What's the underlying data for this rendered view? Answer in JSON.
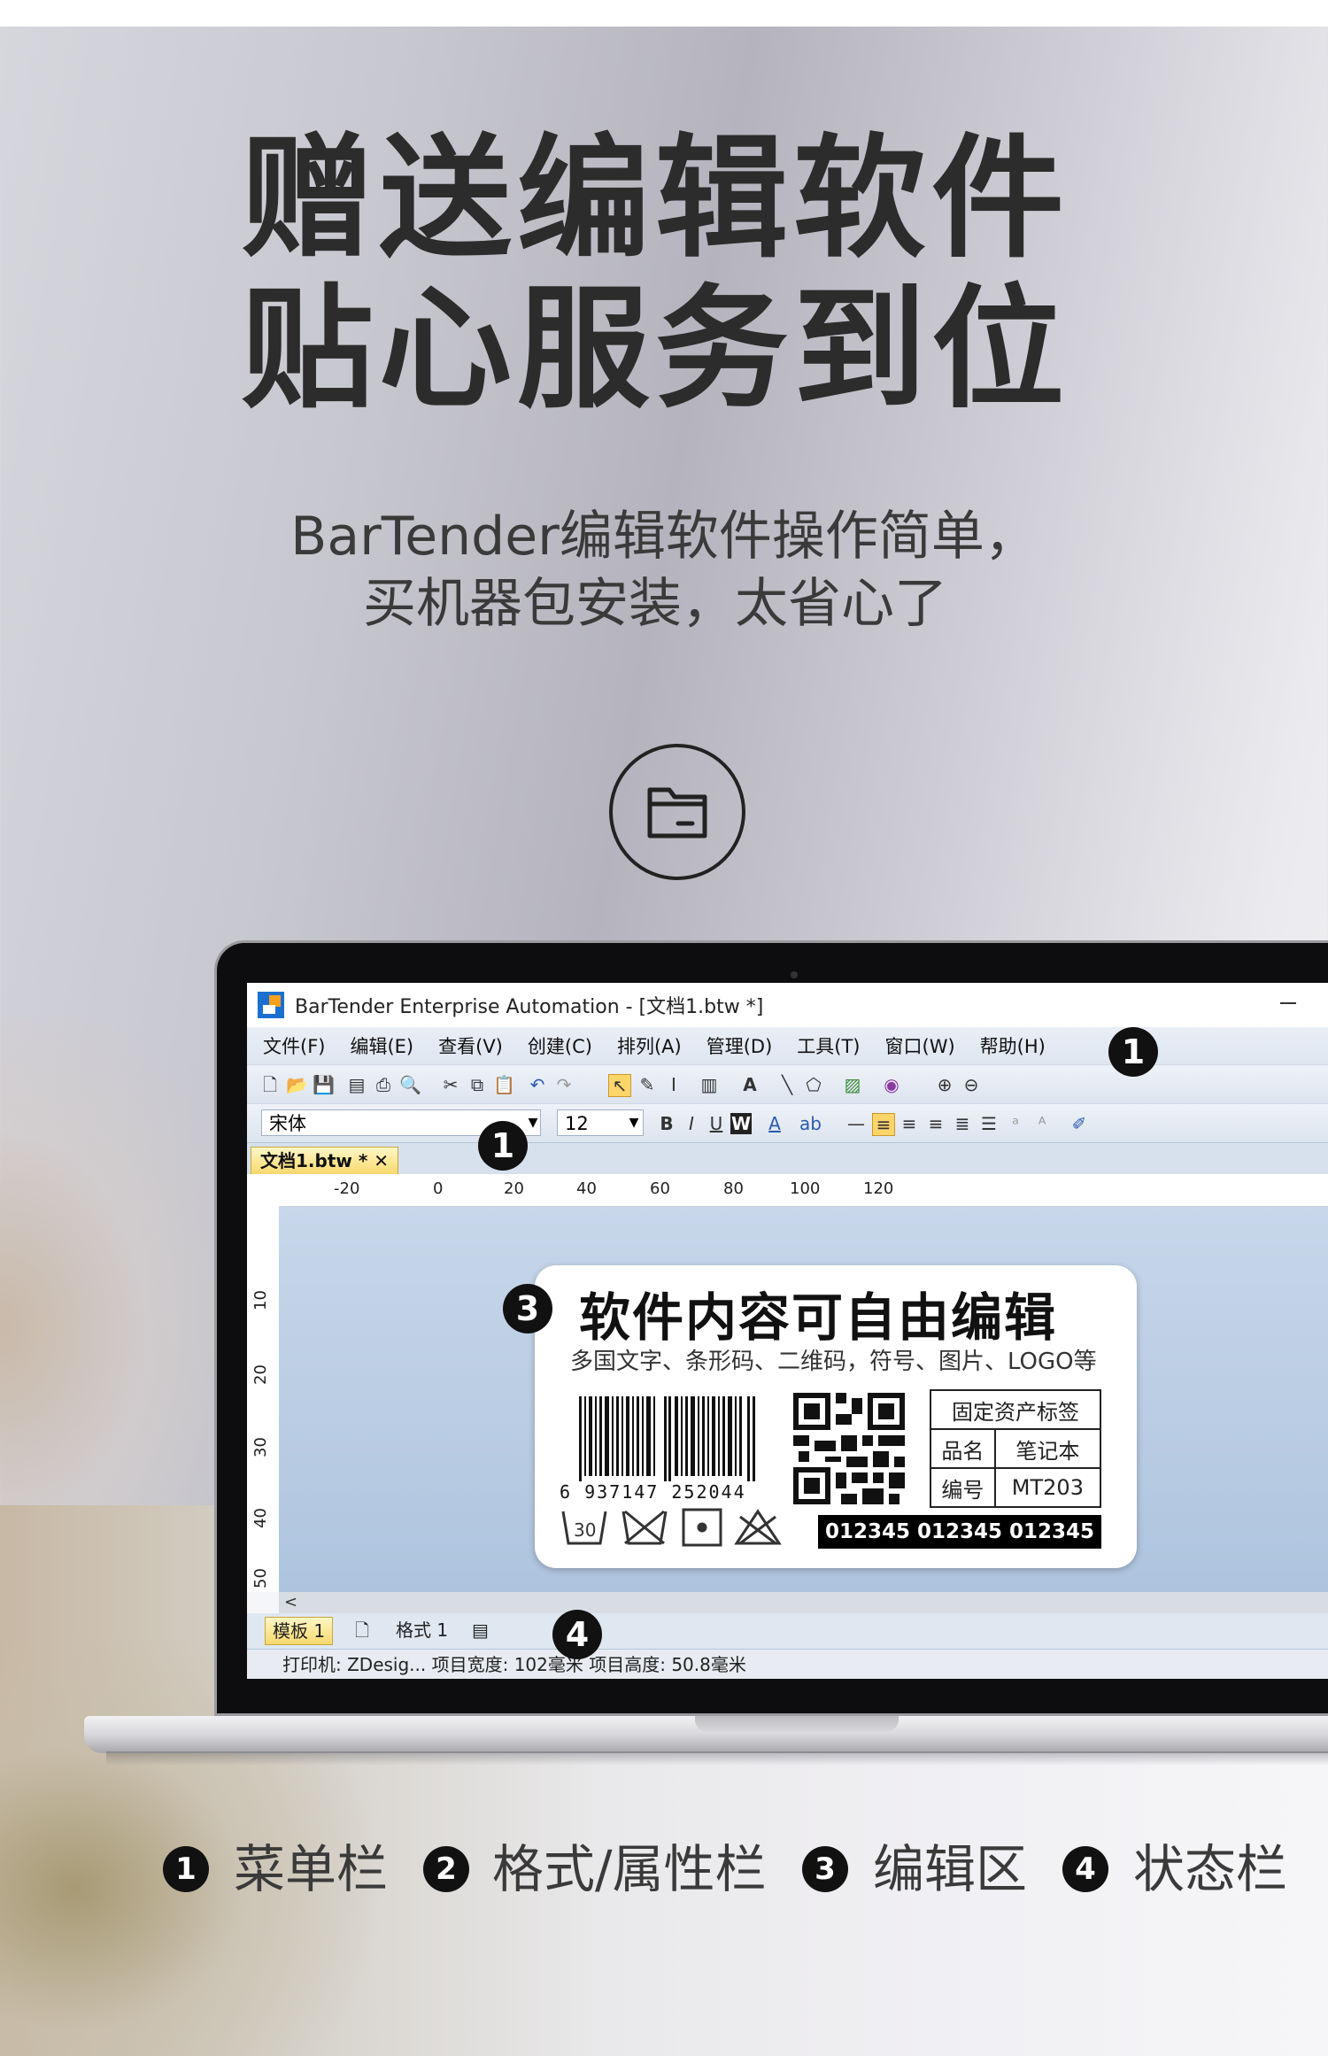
{
  "headline": {
    "line1": "赠送编辑软件",
    "line2": "贴心服务到位"
  },
  "subtitle": {
    "line1": "BarTender编辑软件操作简单，",
    "line2": "买机器包安装，太省心了"
  },
  "folder_icon": "folder-icon",
  "app": {
    "window_title": "BarTender Enterprise Automation - [文档1.btw *]",
    "menu": [
      "文件(F)",
      "编辑(E)",
      "查看(V)",
      "创建(C)",
      "排列(A)",
      "管理(D)",
      "工具(T)",
      "窗口(W)",
      "帮助(H)"
    ],
    "font_name": "宋体",
    "font_size": "12",
    "doc_tab": "文档1.btw *",
    "ruler_h": [
      "-20",
      "0",
      "20",
      "40",
      "60",
      "80",
      "100",
      "120"
    ],
    "ruler_v": [
      "10",
      "20",
      "30",
      "40",
      "50"
    ],
    "bottom_tabs": [
      "模板 1",
      "格式 1"
    ],
    "status": "打印机: ZDesig...  项目宽度: 102毫米  项目高度: 50.8毫米"
  },
  "label": {
    "title": "软件内容可自由编辑",
    "subtitle": "多国文字、条形码、二维码，符号、图片、LOGO等",
    "barcode_number": "6 937147 252044",
    "asset_header": "固定资产标签",
    "asset_rows": [
      [
        "品名",
        "笔记本"
      ],
      [
        "编号",
        "MT203"
      ]
    ],
    "codes": "012345 012345 012345"
  },
  "markers": {
    "menu": "1",
    "format": "1",
    "edit": "3",
    "status": "4"
  },
  "legend": [
    {
      "num": "1",
      "text": "菜单栏"
    },
    {
      "num": "2",
      "text": "格式/属性栏"
    },
    {
      "num": "3",
      "text": "编辑区"
    },
    {
      "num": "4",
      "text": "状态栏"
    }
  ]
}
